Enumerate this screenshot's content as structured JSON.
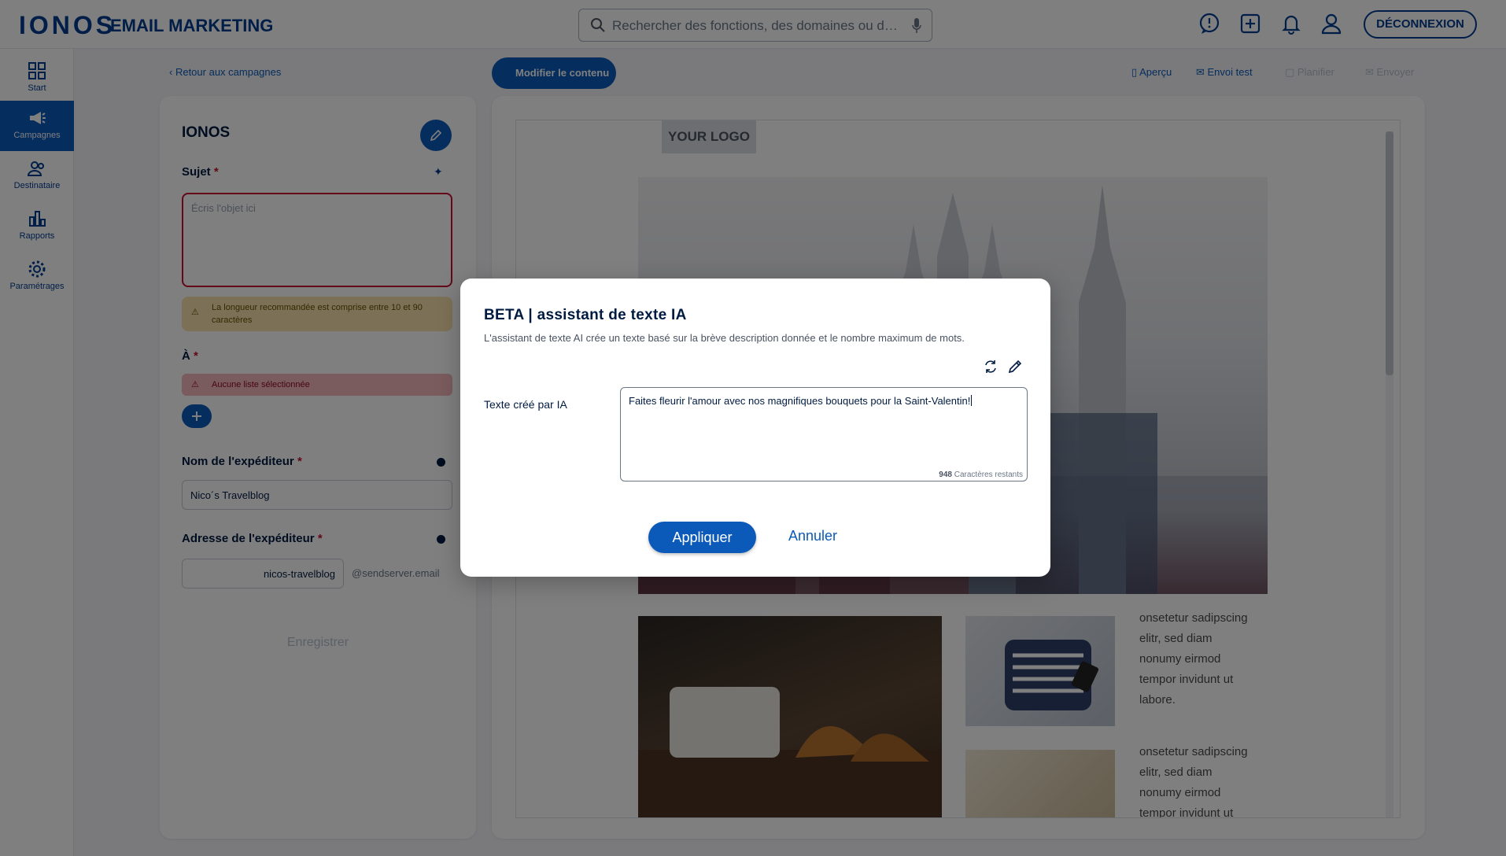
{
  "header": {
    "logo": "IONOS",
    "app_name": "EMAIL MARKETING",
    "search_placeholder": "Rechercher des fonctions, des domaines ou de l'...",
    "logout_label": "DÉCONNEXION"
  },
  "sidebar": {
    "items": [
      {
        "label": "Start",
        "icon": "dashboard-icon"
      },
      {
        "label": "Campagnes",
        "icon": "megaphone-icon",
        "active": true
      },
      {
        "label": "Destinataire",
        "icon": "users-icon"
      },
      {
        "label": "Rapports",
        "icon": "bar-chart-icon"
      },
      {
        "label": "Paramétrages",
        "icon": "gear-icon"
      }
    ]
  },
  "toolbar": {
    "back_label": "Retour aux campagnes",
    "edit_content_label": "Modifier le contenu",
    "preview_label": "Aperçu",
    "send_test_label": "Envoi test",
    "schedule_label": "Planifier",
    "send_label": "Envoyer"
  },
  "campaign_form": {
    "title": "IONOS",
    "subject_label": "Sujet",
    "subject_placeholder": "Écris l'objet ici",
    "subject_warning": "La longueur recommandée est comprise entre 10 et 90 caractères",
    "to_label": "À",
    "to_error": "Aucune liste sélectionnée",
    "sender_name_label": "Nom de l'expéditeur",
    "sender_name_value": "Nico´s Travelblog",
    "sender_address_label": "Adresse de l'expéditeur",
    "sender_address_value": "nicos-travelblog",
    "sender_domain": "@sendserver.email",
    "save_label": "Enregistrer",
    "required_mark": "*"
  },
  "email_preview": {
    "logo_placeholder": "YOUR LOGO",
    "block1_text": "onsetetur sadipscing elitr, sed diam nonumy eirmod tempor invidunt ut labore.",
    "block2_text": "onsetetur sadipscing elitr, sed diam nonumy eirmod tempor invidunt ut"
  },
  "modal": {
    "title": "BETA | assistant de texte IA",
    "description": "L'assistant de texte AI crée un texte basé sur la brève description donnée et le nombre maximum de mots.",
    "field_label": "Texte créé par IA",
    "field_value": "Faites fleurir l'amour avec nos magnifiques bouquets pour la Saint-Valentin!",
    "remaining_count": "948",
    "remaining_label": "Caractères restants",
    "apply_label": "Appliquer",
    "cancel_label": "Annuler"
  },
  "colors": {
    "brand": "#003d8f",
    "accent": "#0b5aba",
    "error": "#c8102e",
    "warning_bg": "#f9e2ac"
  }
}
